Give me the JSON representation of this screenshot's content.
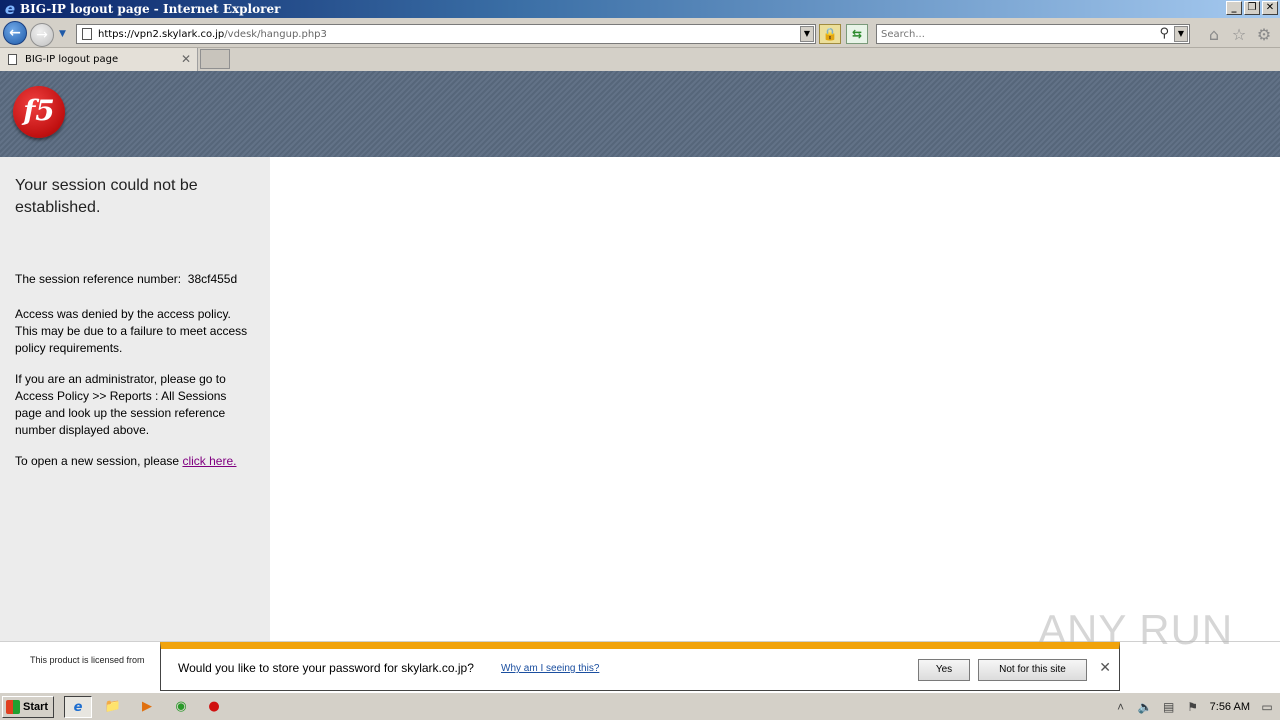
{
  "window": {
    "title": "BIG-IP logout page - Internet Explorer",
    "ie_logo": "e",
    "buttons": [
      "_",
      "❐",
      "✕"
    ]
  },
  "navbar": {
    "url_host": "https://vpn2.skylark.co.jp",
    "url_path": "/vdesk/hangup.php3",
    "search_placeholder": "Search..."
  },
  "tabs": [
    {
      "label": "BIG-IP logout page"
    }
  ],
  "brand": {
    "logo_text": "f5",
    "color": "#d81f26"
  },
  "sidebar": {
    "heading": "Your session could not be established.",
    "ref_label": "The session reference number:",
    "ref_value": "38cf455d",
    "denied_text": "Access was denied by the access policy. This may be due to a failure to meet access policy requirements.",
    "admin_text": "If you are an administrator, please go to Access Policy >> Reports : All Sessions page and look up the session reference number displayed above.",
    "new_session_text": "To open a new session, please",
    "new_session_link": "click here."
  },
  "footer": {
    "license_text": "This product is licensed from"
  },
  "password_bar": {
    "message": "Would you like to store your password for skylark.co.jp?",
    "why_link": "Why am I seeing this?",
    "yes_label": "Yes",
    "no_label": "Not for this site"
  },
  "watermark": "ANY RUN",
  "taskbar": {
    "start_label": "Start",
    "clock": "7:56 AM"
  }
}
